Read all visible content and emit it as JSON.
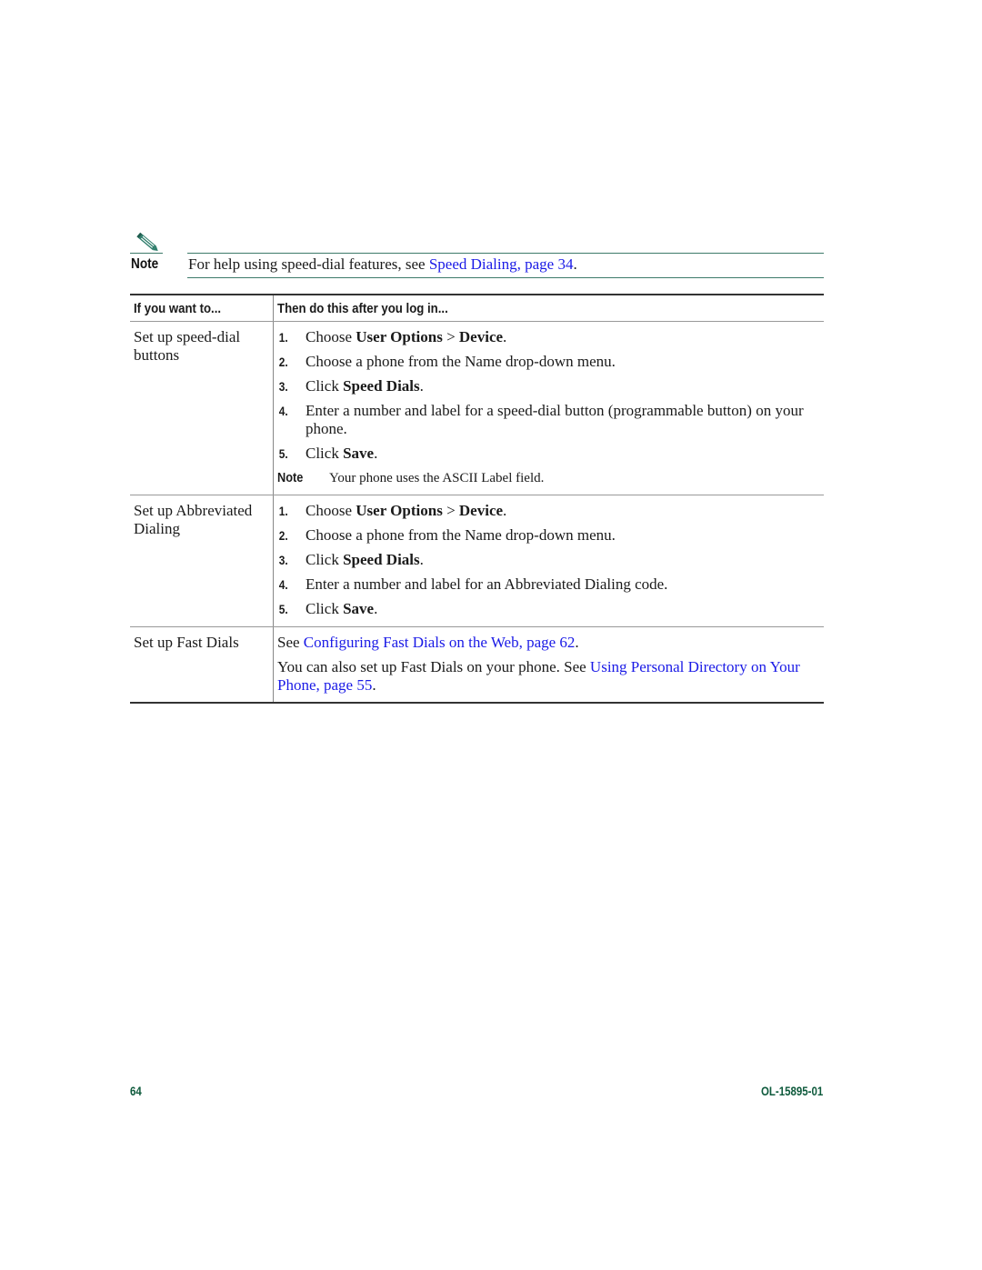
{
  "note": {
    "icon": "pencil-icon",
    "label": "Note",
    "text_before": "For help using speed-dial features, see ",
    "link": "Speed Dialing, page 34",
    "text_after": "."
  },
  "table": {
    "headers": [
      "If you want to...",
      "Then do this after you log in..."
    ],
    "rows": [
      {
        "want": "Set up speed-dial buttons",
        "steps": [
          {
            "num": "1.",
            "parts": [
              {
                "t": "Choose "
              },
              {
                "b": "User Options"
              },
              {
                "t": " > "
              },
              {
                "b": "Device"
              },
              {
                "t": "."
              }
            ]
          },
          {
            "num": "2.",
            "parts": [
              {
                "t": "Choose a phone from the Name drop-down menu."
              }
            ]
          },
          {
            "num": "3.",
            "parts": [
              {
                "t": "Click "
              },
              {
                "b": "Speed Dials"
              },
              {
                "t": "."
              }
            ]
          },
          {
            "num": "4.",
            "parts": [
              {
                "t": "Enter a number and label for a speed-dial button (programmable button) on your phone."
              }
            ]
          },
          {
            "num": "5.",
            "parts": [
              {
                "t": "Click "
              },
              {
                "b": "Save"
              },
              {
                "t": "."
              }
            ]
          }
        ],
        "note": {
          "label": "Note",
          "text": "Your phone uses the ASCII Label field."
        }
      },
      {
        "want": "Set up Abbreviated Dialing",
        "steps": [
          {
            "num": "1.",
            "parts": [
              {
                "t": "Choose "
              },
              {
                "b": "User Options"
              },
              {
                "t": " > "
              },
              {
                "b": "Device"
              },
              {
                "t": "."
              }
            ]
          },
          {
            "num": "2.",
            "parts": [
              {
                "t": "Choose a phone from the Name drop-down menu."
              }
            ]
          },
          {
            "num": "3.",
            "parts": [
              {
                "t": "Click "
              },
              {
                "b": "Speed Dials"
              },
              {
                "t": "."
              }
            ]
          },
          {
            "num": "4.",
            "parts": [
              {
                "t": "Enter a number and label for an Abbreviated Dialing code."
              }
            ]
          },
          {
            "num": "5.",
            "parts": [
              {
                "t": "Click "
              },
              {
                "b": "Save"
              },
              {
                "t": "."
              }
            ]
          }
        ]
      },
      {
        "want": "Set up Fast Dials",
        "paragraphs": [
          {
            "parts": [
              {
                "t": "See "
              },
              {
                "a": "Configuring Fast Dials on the Web, page 62"
              },
              {
                "t": "."
              }
            ]
          },
          {
            "parts": [
              {
                "t": "You can also set up Fast Dials on your phone. See "
              },
              {
                "a": "Using Personal Directory on Your Phone, page 55"
              },
              {
                "t": "."
              }
            ]
          }
        ]
      }
    ]
  },
  "footer": {
    "page_number": "64",
    "doc_id": "OL-15895-01"
  }
}
